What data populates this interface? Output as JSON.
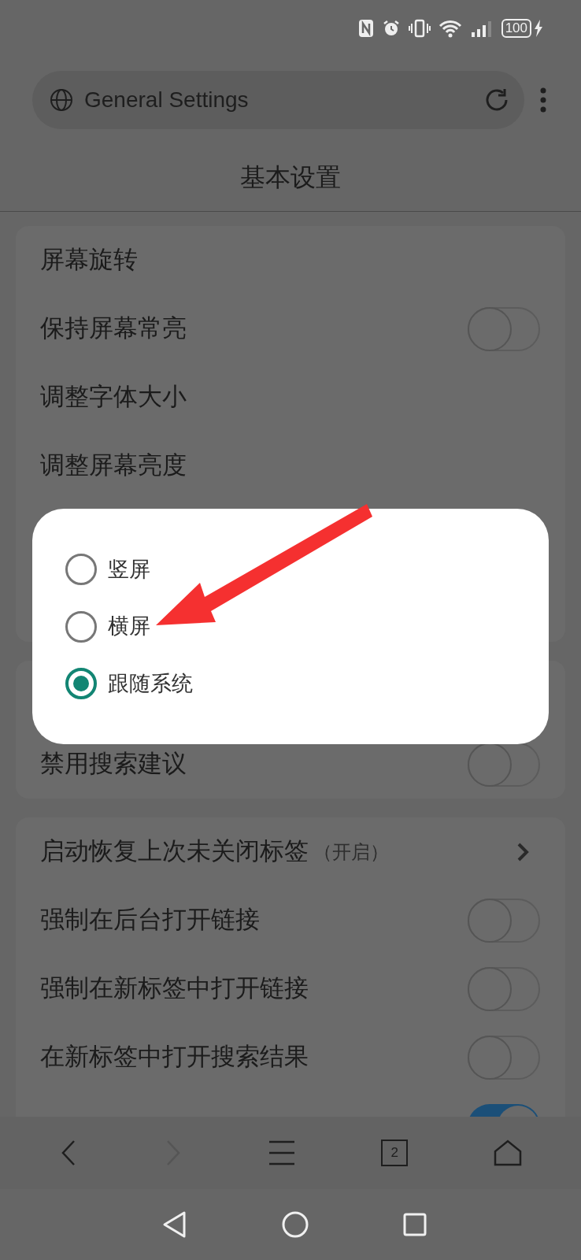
{
  "status_bar": {
    "battery": "100"
  },
  "address_bar": {
    "title": "General Settings"
  },
  "page_title": "基本设置",
  "sections": [
    {
      "items": [
        {
          "label": "屏幕旋转",
          "kind": "plain"
        },
        {
          "label": "保持屏幕常亮",
          "kind": "toggle",
          "on": false
        },
        {
          "label": "调整字体大小",
          "kind": "plain"
        },
        {
          "label": "调整屏幕亮度",
          "kind": "plain"
        }
      ]
    },
    {
      "items": [
        {
          "label": "禁用搜索建议",
          "kind": "toggle",
          "on": false
        }
      ]
    },
    {
      "items": [
        {
          "label": "启动恢复上次未关闭标签",
          "value": "（开启）",
          "kind": "link"
        },
        {
          "label": "强制在后台打开链接",
          "kind": "toggle",
          "on": false
        },
        {
          "label": "强制在新标签中打开链接",
          "kind": "toggle",
          "on": false
        },
        {
          "label": "在新标签中打开搜索结果",
          "kind": "toggle",
          "on": false
        },
        {
          "kind": "toggle",
          "on": true
        }
      ]
    }
  ],
  "dialog": {
    "options": [
      {
        "label": "竖屏",
        "selected": false
      },
      {
        "label": "横屏",
        "selected": false
      },
      {
        "label": "跟随系统",
        "selected": true
      }
    ]
  },
  "toolbar": {
    "tab_count": "2"
  }
}
